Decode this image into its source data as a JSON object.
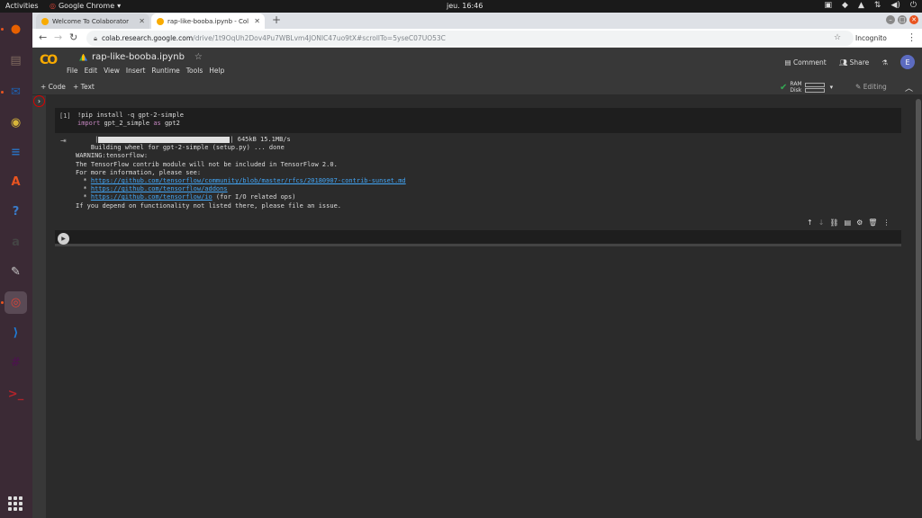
{
  "topbar": {
    "activities": "Activities",
    "app_name": "Google Chrome",
    "clock": "jeu. 16:46"
  },
  "dock": {
    "apps": [
      {
        "name": "firefox",
        "glyph": "●",
        "color": "#e66000"
      },
      {
        "name": "files",
        "glyph": "▤",
        "color": "#7f6a5f"
      },
      {
        "name": "thunderbird",
        "glyph": "✉",
        "color": "#1f5fad"
      },
      {
        "name": "rhythmbox",
        "glyph": "◉",
        "color": "#d8b53a"
      },
      {
        "name": "libreoffice-writer",
        "glyph": "≡",
        "color": "#2a6fbb"
      },
      {
        "name": "software-center",
        "glyph": "A",
        "color": "#e95420"
      },
      {
        "name": "help",
        "glyph": "?",
        "color": "#3a7ac8"
      },
      {
        "name": "amazon",
        "glyph": "a",
        "color": "#444"
      },
      {
        "name": "text-editor",
        "glyph": "✎",
        "color": "#cfcfcf"
      },
      {
        "name": "chrome",
        "glyph": "◎",
        "color": "#db4437"
      },
      {
        "name": "vscode",
        "glyph": "⟩",
        "color": "#1f7bd6"
      },
      {
        "name": "slack",
        "glyph": "#",
        "color": "#4a154b"
      },
      {
        "name": "terminal",
        "glyph": ">_",
        "color": "#b3232b"
      }
    ]
  },
  "browser": {
    "tabs": [
      {
        "label": "Welcome To Colaborator",
        "active": false
      },
      {
        "label": "rap-like-booba.ipynb - Col",
        "active": true
      }
    ],
    "url_host": "colab.research.google.com",
    "url_path": "/drive/1t9OqUh2Dov4Pu7WBLvm4JONIC47uo9tX#scrollTo=5yseC07UO53C",
    "incognito_label": "Incognito"
  },
  "colab": {
    "notebook_title": "rap-like-booba.ipynb",
    "menu": [
      "File",
      "Edit",
      "View",
      "Insert",
      "Runtime",
      "Tools",
      "Help"
    ],
    "comment_label": "Comment",
    "share_label": "Share",
    "avatar_letter": "E",
    "add_code_label": "+ Code",
    "add_text_label": "+ Text",
    "ram_label": "RAM",
    "disk_label": "Disk",
    "editing_label": "Editing",
    "cell1": {
      "exec_count": "[1]",
      "line1": "!pip install -q gpt-2-simple",
      "line2_kw": "import",
      "line2_mod": " gpt_2_simple ",
      "line2_as": "as",
      "line2_alias": " gpt2"
    },
    "output": {
      "progress_text": "| 645kB 15.1MB/s",
      "line_building": "    Building wheel for gpt-2-simple (setup.py) ... done",
      "line_warning": "WARNING:tensorflow:",
      "line_contrib": "The TensorFlow contrib module will not be included in TensorFlow 2.0.",
      "line_more": "For more information, please see:",
      "link1": "https://github.com/tensorflow/community/blob/master/rfcs/20180907-contrib-sunset.md",
      "link2": "https://github.com/tensorflow/addons",
      "link3": "https://github.com/tensorflow/io",
      "link3_suffix": " (for I/O related ops)",
      "line_last": "If you depend on functionality not listed there, please file an issue."
    }
  }
}
